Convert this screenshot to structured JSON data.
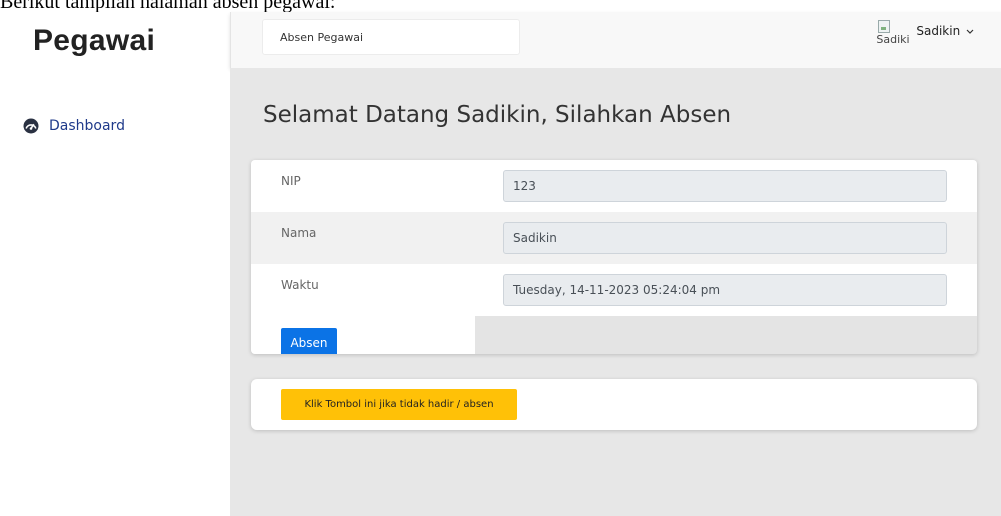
{
  "caption": "Berikut tampilan halaman absen pegawai:",
  "sidebar": {
    "brand": "Pegawai",
    "items": [
      {
        "label": "Dashboard",
        "icon": "dashboard-icon"
      }
    ]
  },
  "topbar": {
    "search_value": "Absen Pegawai",
    "avatar_alt": "Sadiki",
    "user_name": "Sadikin",
    "dropdown_icon": "chevron-down-icon"
  },
  "main": {
    "welcome": "Selamat Datang Sadikin, Silahkan Absen",
    "form": {
      "nip_label": "NIP",
      "nip_value": "123",
      "nama_label": "Nama",
      "nama_value": "Sadikin",
      "waktu_label": "Waktu",
      "waktu_value": "Tuesday, 14-11-2023 05:24:04 pm",
      "submit_label": "Absen"
    },
    "absent_button": "Klik Tombol ini jika tidak hadir / absen"
  },
  "colors": {
    "primary": "#0b73e6",
    "warning": "#ffc107",
    "content_bg": "#e7e7e7"
  }
}
